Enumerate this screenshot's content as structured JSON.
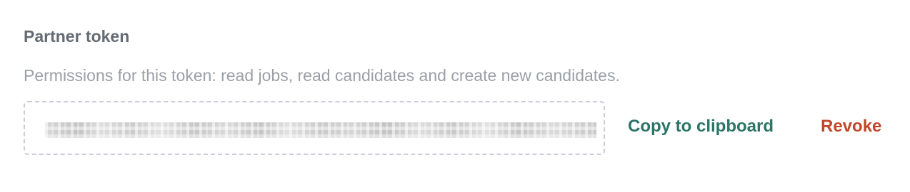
{
  "token_section": {
    "title": "Partner token",
    "description": "Permissions for this token: read jobs, read candidates and create new candidates.",
    "token_value": "",
    "copy_label": "Copy to clipboard",
    "revoke_label": "Revoke"
  },
  "colors": {
    "title": "#646b73",
    "description": "#9aa0a6",
    "token_border": "#c8ccdb",
    "copy_action": "#2b7566",
    "revoke_action": "#c2472a"
  }
}
